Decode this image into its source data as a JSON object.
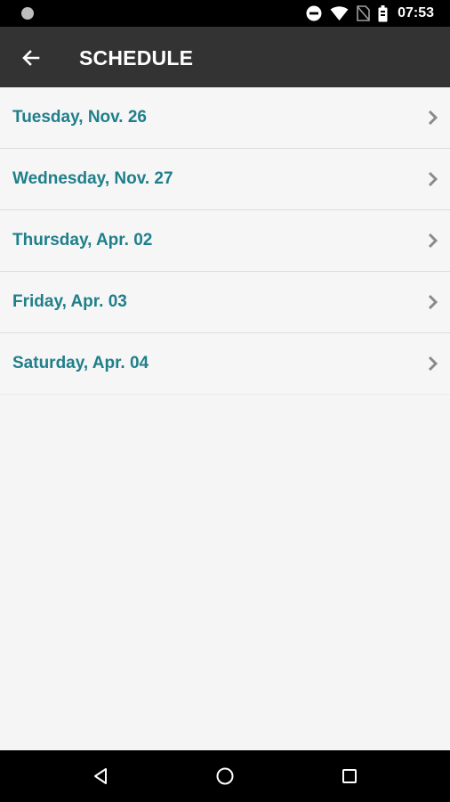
{
  "status_bar": {
    "time": "07:53",
    "icons": [
      "notification-dot-icon",
      "do-not-disturb-icon",
      "wifi-icon",
      "no-sim-icon",
      "battery-icon"
    ]
  },
  "app_bar": {
    "title": "SCHEDULE",
    "back_icon": "arrow-left-icon",
    "background": "#333333"
  },
  "schedule": {
    "accent_color": "#1f7f8a",
    "days": [
      {
        "label": "Tuesday, Nov. 26"
      },
      {
        "label": "Wednesday, Nov. 27"
      },
      {
        "label": "Thursday, Apr. 02"
      },
      {
        "label": "Friday, Apr. 03"
      },
      {
        "label": "Saturday, Apr. 04"
      }
    ]
  },
  "nav_bar": {
    "buttons": [
      "back-triangle-icon",
      "home-circle-icon",
      "recents-square-icon"
    ]
  }
}
